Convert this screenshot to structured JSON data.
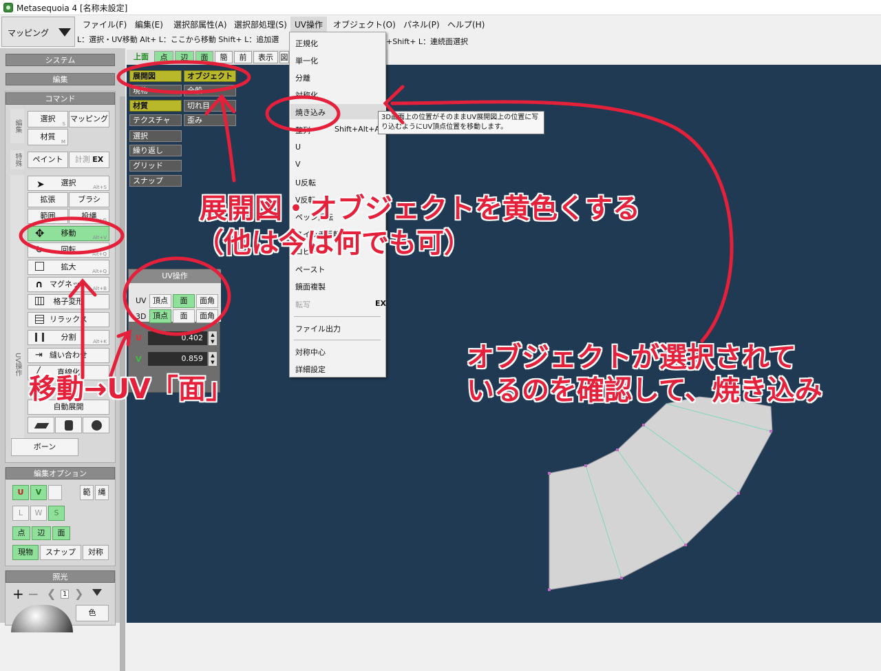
{
  "window": {
    "title": "Metasequoia 4 [名称未設定]"
  },
  "mode_select": {
    "value": "マッピング"
  },
  "menu": [
    "ファイル(F)",
    "編集(E)",
    "選択部属性(A)",
    "選択部処理(S)",
    "UV操作",
    "オブジェクト(O)",
    "パネル(P)",
    "ヘルプ(H)"
  ],
  "hint_bar": "L：選択・UV移動  Alt+ L：ここから移動  Shift+ L：追加選",
  "hint_bar_right": "+Shift+ L：連続面選択",
  "left_panel": {
    "system": "システム",
    "edit": "編集",
    "command": "コマンド",
    "group_edit": "編集",
    "group_special": "特殊",
    "group_uv": "UV操作",
    "select": "選択",
    "select_key": "S",
    "mapping": "マッピング",
    "material": "材質",
    "material_key": "M",
    "paint": "ペイント",
    "measure": "計測",
    "ex": "EX",
    "tool_select": "選択",
    "tool_select_key": "Alt+S",
    "expand": "拡張",
    "brush": "ブラシ",
    "range": "範囲",
    "lasso": "投縄",
    "lasso_key": "Alt+G",
    "move": "移動",
    "move_key": "Alt+V",
    "rotate": "回転",
    "rotate_key": "Alt+Q",
    "scale": "拡大",
    "scale_key": "Alt+Q",
    "magnet": "マグネット",
    "magnet_key": "Alt+B",
    "lattice": "格子変形",
    "relax": "リラックス",
    "split": "分割",
    "split_key": "Alt+K",
    "sew": "縫い合わせ",
    "straight": "直線化",
    "auto_unfold": "自動展開",
    "bone": "ボーン",
    "edit_options": "編集オプション",
    "opt_u": "U",
    "opt_v": "V",
    "opt_range": "範",
    "opt_rope": "縄",
    "opt_l": "L",
    "opt_w": "W",
    "opt_s": "S",
    "opt_point": "点",
    "opt_edge": "辺",
    "opt_face": "面",
    "opt_current": "現物",
    "opt_snap": "スナップ",
    "opt_sym": "対称",
    "light": "照光",
    "light_index": "1",
    "color": "色"
  },
  "view_tabs": [
    "上面",
    "点",
    "辺",
    "面",
    "簡",
    "前",
    "表示",
    "図"
  ],
  "view_panel": {
    "left": [
      "展開図",
      "現物",
      "材質",
      "テクスチャ",
      "選択",
      "繰り返し",
      "グリッド",
      "スナップ"
    ],
    "right": [
      "オブジェクト",
      "全般",
      "切れ目",
      "歪み"
    ]
  },
  "uv_panel": {
    "title": "UV操作",
    "row_uv": "UV",
    "row_3d": "3D",
    "vertex": "頂点",
    "face": "面",
    "face_corner": "面角",
    "u_label": "U",
    "v_label": "V",
    "u_value": "0.402",
    "v_value": "0.859"
  },
  "dropdown": {
    "items": [
      "正規化",
      "単一化",
      "分離",
      "対称化",
      "焼き込み",
      "整列",
      "U",
      "V",
      "U反転",
      "V反転",
      "ペッシ反転",
      "スイッチ反転",
      "コピー",
      "ペースト",
      "鏡面複製",
      "転写",
      "ファイル出力",
      "対称中心",
      "詳細設定"
    ],
    "align_shortcut": "Shift+Alt+A",
    "ex_badge": "EX"
  },
  "tooltip": "3D画面上の位置がそのままUV展開図上の位置に写り込むようにUV頂点位置を移動します。",
  "annotations": {
    "line1": "展開図・オブジェクトを黄色くする",
    "line2": "（他は今は何でも可）",
    "move_note": "移動→UV「面」",
    "bake_line1": "オブジェクトが選択されて",
    "bake_line2": "いるのを確認して、焼き込み"
  },
  "colors": {
    "viewport": "#1f3a52",
    "highlight_yellow": "#b8b82a",
    "toggle_green": "#8fe09a",
    "annotation_red": "#e5203a",
    "mesh_fill": "#d4d4d4"
  }
}
